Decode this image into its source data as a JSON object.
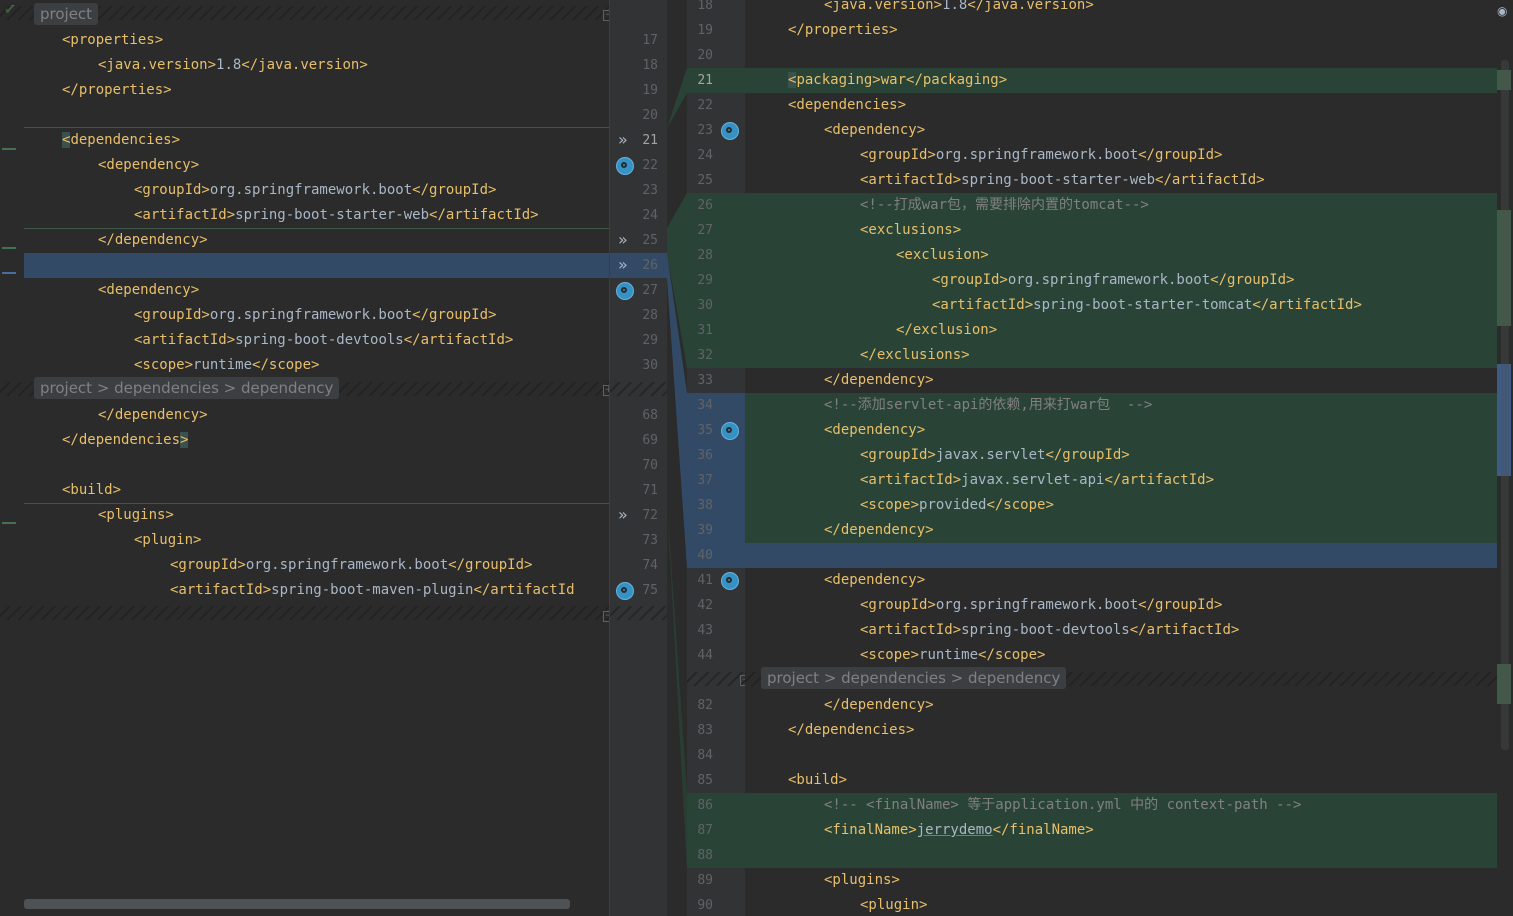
{
  "left": {
    "breadcrumb_top": "project",
    "breadcrumb_mid": "project > dependencies > dependency",
    "lines": [
      {
        "n": "17",
        "tag1": "<properties>",
        "val": "",
        "tag2": ""
      },
      {
        "n": "18",
        "tag1": "<java.version>",
        "val": "1.8",
        "tag2": "</java.version>"
      },
      {
        "n": "19",
        "tag1": "</properties>",
        "val": "",
        "tag2": ""
      },
      {
        "n": "20",
        "tag1": "",
        "val": "",
        "tag2": ""
      },
      {
        "n": "21",
        "tag1": "<",
        "val": "",
        "tag2": "dependencies>"
      },
      {
        "n": "22",
        "tag1": "<dependency>",
        "val": "",
        "tag2": ""
      },
      {
        "n": "23",
        "tag1": "<groupId>",
        "val": "org.springframework.boot",
        "tag2": "</groupId>"
      },
      {
        "n": "24",
        "tag1": "<artifactId>",
        "val": "spring-boot-starter-web",
        "tag2": "</artifactId>"
      },
      {
        "n": "25",
        "tag1": "</dependency>",
        "val": "",
        "tag2": ""
      },
      {
        "n": "26",
        "tag1": "",
        "val": "",
        "tag2": ""
      },
      {
        "n": "27",
        "tag1": "<dependency>",
        "val": "",
        "tag2": ""
      },
      {
        "n": "28",
        "tag1": "<groupId>",
        "val": "org.springframework.boot",
        "tag2": "</groupId>"
      },
      {
        "n": "29",
        "tag1": "<artifactId>",
        "val": "spring-boot-devtools",
        "tag2": "</artifactId>"
      },
      {
        "n": "30",
        "tag1": "<scope>",
        "val": "runtime",
        "tag2": "</scope>"
      },
      {
        "n": "68",
        "tag1": "</dependency>",
        "val": "",
        "tag2": ""
      },
      {
        "n": "69",
        "tag1": "</dependencies",
        "val": "",
        "tag2": ">"
      },
      {
        "n": "70",
        "tag1": "",
        "val": "",
        "tag2": ""
      },
      {
        "n": "71",
        "tag1": "<build>",
        "val": "",
        "tag2": ""
      },
      {
        "n": "72",
        "tag1": "<plugins>",
        "val": "",
        "tag2": ""
      },
      {
        "n": "73",
        "tag1": "<plugin>",
        "val": "",
        "tag2": ""
      },
      {
        "n": "74",
        "tag1": "<groupId>",
        "val": "org.springframework.boot",
        "tag2": "</groupId>"
      },
      {
        "n": "75",
        "tag1": "<artifactId>",
        "val": "spring-boot-maven-plugin",
        "tag2": "</artifactId"
      }
    ]
  },
  "right": {
    "breadcrumb_mid": "project > dependencies > dependency",
    "lines": [
      {
        "n": "18",
        "tag1": "<java.version>",
        "val": "1.8",
        "tag2": "</java.version>"
      },
      {
        "n": "19",
        "tag1": "</properties>",
        "val": "",
        "tag2": ""
      },
      {
        "n": "20",
        "tag1": "",
        "val": "",
        "tag2": ""
      },
      {
        "n": "21",
        "tag1": "<",
        "val": "",
        "tag2": "packaging>war</packaging>"
      },
      {
        "n": "22",
        "tag1": "<dependencies>",
        "val": "",
        "tag2": ""
      },
      {
        "n": "23",
        "tag1": "<dependency>",
        "val": "",
        "tag2": ""
      },
      {
        "n": "24",
        "tag1": "<groupId>",
        "val": "org.springframework.boot",
        "tag2": "</groupId>"
      },
      {
        "n": "25",
        "tag1": "<artifactId>",
        "val": "spring-boot-starter-web",
        "tag2": "</artifactId>"
      },
      {
        "n": "26",
        "comment": "<!--打成war包，需要排除内置的tomcat-->"
      },
      {
        "n": "27",
        "tag1": "<exclusions>",
        "val": "",
        "tag2": ""
      },
      {
        "n": "28",
        "tag1": "<exclusion>",
        "val": "",
        "tag2": ""
      },
      {
        "n": "29",
        "tag1": "<groupId>",
        "val": "org.springframework.boot",
        "tag2": "</groupId>"
      },
      {
        "n": "30",
        "tag1": "<artifactId>",
        "val": "spring-boot-starter-tomcat",
        "tag2": "</artifactId>"
      },
      {
        "n": "31",
        "tag1": "</exclusion>",
        "val": "",
        "tag2": ""
      },
      {
        "n": "32",
        "tag1": "</exclusions>",
        "val": "",
        "tag2": ""
      },
      {
        "n": "33",
        "tag1": "</dependency>",
        "val": "",
        "tag2": ""
      },
      {
        "n": "34",
        "comment": "<!--添加servlet-api的依赖,用来打war包  -->"
      },
      {
        "n": "35",
        "tag1": "<dependency>",
        "val": "",
        "tag2": ""
      },
      {
        "n": "36",
        "tag1": "<groupId>",
        "val": "javax.servlet",
        "tag2": "</groupId>"
      },
      {
        "n": "37",
        "tag1": "<artifactId>",
        "val": "javax.servlet-api",
        "tag2": "</artifactId>"
      },
      {
        "n": "38",
        "tag1": "<scope>",
        "val": "provided",
        "tag2": "</scope>"
      },
      {
        "n": "39",
        "tag1": "</dependency>",
        "val": "",
        "tag2": ""
      },
      {
        "n": "40",
        "tag1": "",
        "val": "",
        "tag2": ""
      },
      {
        "n": "41",
        "tag1": "<dependency>",
        "val": "",
        "tag2": ""
      },
      {
        "n": "42",
        "tag1": "<groupId>",
        "val": "org.springframework.boot",
        "tag2": "</groupId>"
      },
      {
        "n": "43",
        "tag1": "<artifactId>",
        "val": "spring-boot-devtools",
        "tag2": "</artifactId>"
      },
      {
        "n": "44",
        "tag1": "<scope>",
        "val": "runtime",
        "tag2": "</scope>"
      },
      {
        "n": "82",
        "tag1": "</dependency>",
        "val": "",
        "tag2": ""
      },
      {
        "n": "83",
        "tag1": "</dependencies>",
        "val": "",
        "tag2": ""
      },
      {
        "n": "84",
        "tag1": "",
        "val": "",
        "tag2": ""
      },
      {
        "n": "85",
        "tag1": "<build>",
        "val": "",
        "tag2": ""
      },
      {
        "n": "86",
        "comment": "<!-- <finalName> 等于application.yml 中的 context-path -->"
      },
      {
        "n": "87",
        "tag1": "<finalName>",
        "val": "jerrydemo",
        "tag2": "</finalName>"
      },
      {
        "n": "88",
        "tag1": "",
        "val": "",
        "tag2": ""
      },
      {
        "n": "89",
        "tag1": "<plugins>",
        "val": "",
        "tag2": ""
      },
      {
        "n": "90",
        "tag1": "<plugin>",
        "val": "",
        "tag2": ""
      }
    ]
  }
}
